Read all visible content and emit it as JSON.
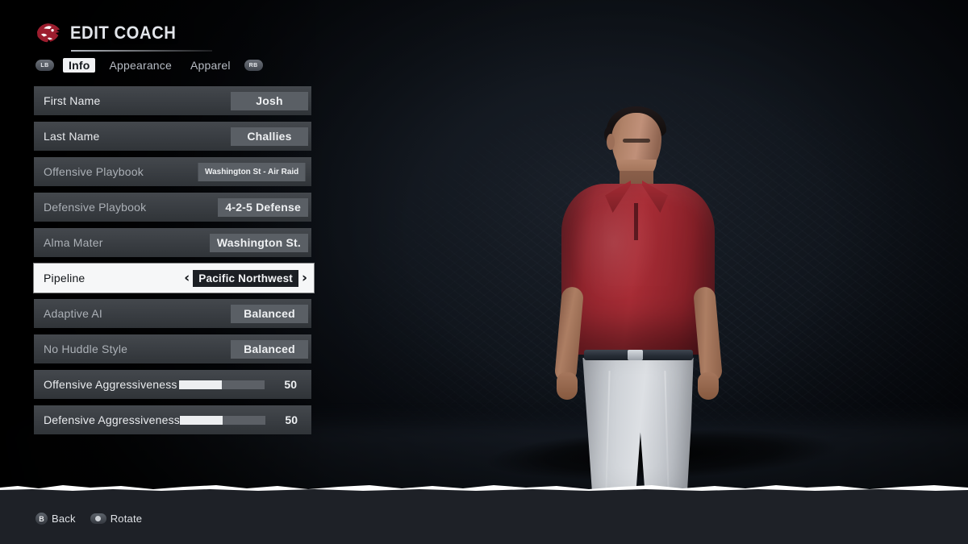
{
  "header": {
    "title": "EDIT COACH",
    "logo_icon": "cougar-head-logo"
  },
  "tabs": {
    "left_bumper": "LB",
    "right_bumper": "RB",
    "items": [
      {
        "label": "Info",
        "active": true
      },
      {
        "label": "Appearance",
        "active": false
      },
      {
        "label": "Apparel",
        "active": false
      }
    ]
  },
  "form": {
    "rows": [
      {
        "label": "First Name",
        "value": "Josh",
        "type": "value",
        "dim": false,
        "selected": false
      },
      {
        "label": "Last Name",
        "value": "Challies",
        "type": "value",
        "dim": false,
        "selected": false
      },
      {
        "label": "Offensive Playbook",
        "value": "Washington St - Air Raid",
        "type": "value",
        "dim": true,
        "selected": false
      },
      {
        "label": "Defensive Playbook",
        "value": "4-2-5 Defense",
        "type": "value",
        "dim": true,
        "selected": false
      },
      {
        "label": "Alma Mater",
        "value": "Washington St.",
        "type": "value",
        "dim": true,
        "selected": false
      },
      {
        "label": "Pipeline",
        "value": "Pacific Northwest",
        "type": "selector",
        "dim": false,
        "selected": true,
        "prev_arrow": "‹",
        "next_arrow": "›"
      },
      {
        "label": "Adaptive AI",
        "value": "Balanced",
        "type": "value",
        "dim": true,
        "selected": false
      },
      {
        "label": "No Huddle Style",
        "value": "Balanced",
        "type": "value",
        "dim": true,
        "selected": false
      },
      {
        "label": "Offensive Aggressiveness",
        "value": "50",
        "type": "slider",
        "dim": false,
        "selected": false,
        "percent": 50
      },
      {
        "label": "Defensive Aggressiveness",
        "value": "50",
        "type": "slider",
        "dim": false,
        "selected": false,
        "percent": 50
      }
    ]
  },
  "footer": {
    "hints": [
      {
        "glyph": "B",
        "glyph_type": "button",
        "label": "Back"
      },
      {
        "glyph": "left-stick",
        "glyph_type": "stick",
        "label": "Rotate"
      }
    ]
  },
  "scene": {
    "subject": "coach-character-model",
    "shirt_color": "#a92d36",
    "pants_color": "#dde0e4"
  },
  "colors": {
    "accent": "#a12a32",
    "row_bg": "#3a3e43",
    "pill_bg": "#5a5f65",
    "selected_bg": "#f6f7f8",
    "footer_bg": "#1e2127"
  }
}
